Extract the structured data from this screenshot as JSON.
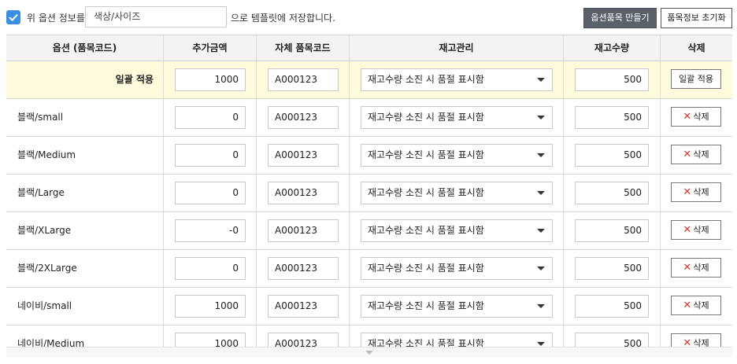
{
  "topbar": {
    "checkbox_checked": true,
    "label": "위 옵션 정보를",
    "template_value": "색상/사이즈",
    "suffix": "으로 템플릿에 저장합니다.",
    "create_button": "옵션품목 만들기",
    "reset_button": "품목정보 초기화"
  },
  "columns": [
    "옵션 (품목코드)",
    "추가금액",
    "자체 품목코드",
    "재고관리",
    "재고수량",
    "삭제"
  ],
  "bulk": {
    "label": "일괄 적용",
    "price": "1000",
    "code": "A000123",
    "stock_mgmt": "재고수량 소진 시 품절 표시함",
    "qty": "500",
    "apply_button": "일괄 적용"
  },
  "rows": [
    {
      "name": "블랙/small",
      "price": "0",
      "code": "A000123",
      "stock_mgmt": "재고수량 소진 시 품절 표시함",
      "qty": "500",
      "delete": "삭제"
    },
    {
      "name": "블랙/Medium",
      "price": "0",
      "code": "A000123",
      "stock_mgmt": "재고수량 소진 시 품절 표시함",
      "qty": "500",
      "delete": "삭제"
    },
    {
      "name": "블랙/Large",
      "price": "0",
      "code": "A000123",
      "stock_mgmt": "재고수량 소진 시 품절 표시함",
      "qty": "500",
      "delete": "삭제"
    },
    {
      "name": "블랙/XLarge",
      "price": "-0",
      "code": "A000123",
      "stock_mgmt": "재고수량 소진 시 품절 표시함",
      "qty": "500",
      "delete": "삭제"
    },
    {
      "name": "블랙/2XLarge",
      "price": "0",
      "code": "A000123",
      "stock_mgmt": "재고수량 소진 시 품절 표시함",
      "qty": "500",
      "delete": "삭제"
    },
    {
      "name": "네이비/small",
      "price": "1000",
      "code": "A000123",
      "stock_mgmt": "재고수량 소진 시 품절 표시함",
      "qty": "500",
      "delete": "삭제"
    },
    {
      "name": "네이비/Medium",
      "price": "1000",
      "code": "A000123",
      "stock_mgmt": "재고수량 소진 시 품절 표시함",
      "qty": "500",
      "delete": "삭제"
    }
  ],
  "icons": {
    "checkbox": "check-icon",
    "select": "chevron-down-icon",
    "delete": "x-icon"
  },
  "colors": {
    "accent": "#3a8fe0",
    "bulk_row": "#fffbdc",
    "delete_x": "#d9342b",
    "dark_button": "#5a6169"
  }
}
